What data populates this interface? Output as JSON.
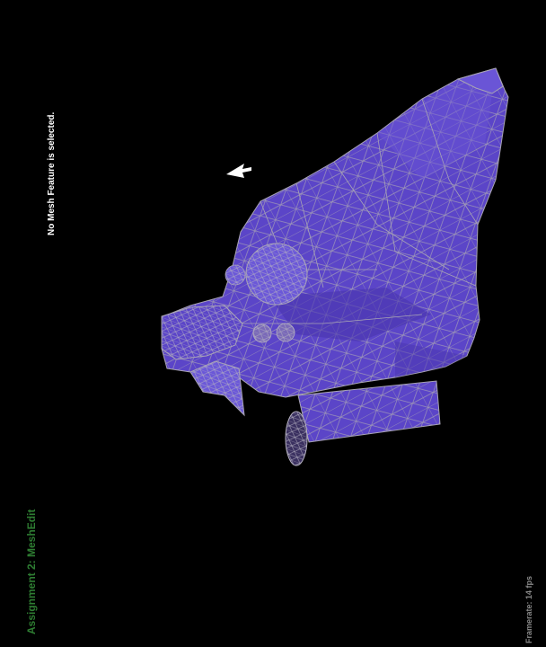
{
  "app": {
    "title": "Assignment 2: MeshEdit",
    "title_color": "#2e7d32"
  },
  "status": {
    "selection_message": "No Mesh Feature is selected."
  },
  "stats": {
    "framerate_text": "Framerate: 14 fps"
  },
  "viewport": {
    "background": "#000000",
    "mesh": {
      "subject": "dog-head-wireframe",
      "face_color": "#5b45c8",
      "edge_color": "#a8a4b4",
      "render_mode": "shaded with wireframe edges"
    },
    "cursor_icon": "arrow-cursor-icon"
  }
}
